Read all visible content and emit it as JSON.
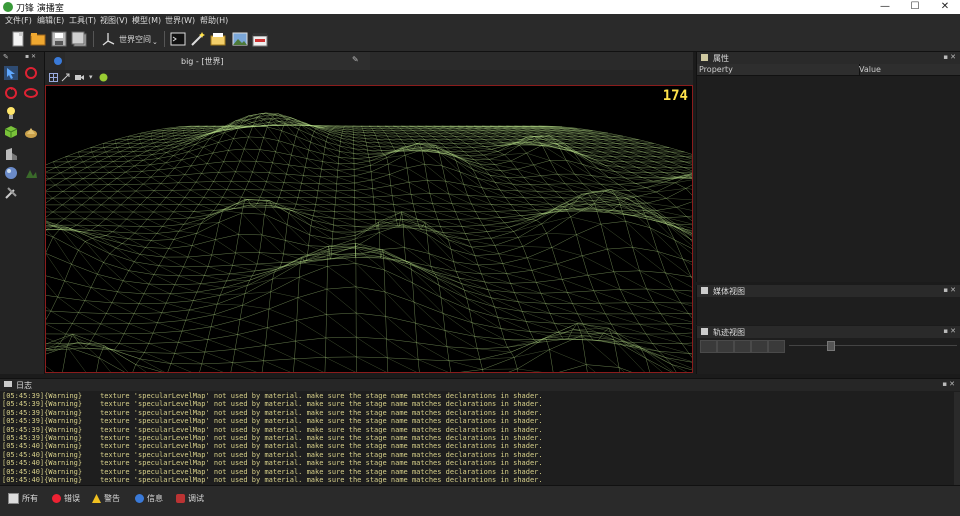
{
  "window": {
    "title": "刀锋 演播室",
    "min": "—",
    "max": "☐",
    "close": "✕"
  },
  "menu": [
    "文件(F)",
    "编辑(E)",
    "工具(T)",
    "视图(V)",
    "模型(M)",
    "世界(W)",
    "帮助(H)"
  ],
  "toolbar": {
    "coord_space": "世界空间"
  },
  "viewport": {
    "tab_title": "big - [世界]",
    "fps": "174"
  },
  "properties": {
    "title": "属性",
    "col_property": "Property",
    "col_value": "Value"
  },
  "media": {
    "title": "媒体视图"
  },
  "track": {
    "title": "轨迹视图"
  },
  "log": {
    "title": "日志",
    "lines": [
      {
        "ts": "[05:45:39]",
        "level": "{Warning}",
        "msg": "texture 'specularLevelMap' not used by material. make sure the stage name matches declarations in shader."
      },
      {
        "ts": "[05:45:39]",
        "level": "{Warning}",
        "msg": "texture 'specularLevelMap' not used by material. make sure the stage name matches declarations in shader."
      },
      {
        "ts": "[05:45:39]",
        "level": "{Warning}",
        "msg": "texture 'specularLevelMap' not used by material. make sure the stage name matches declarations in shader."
      },
      {
        "ts": "[05:45:39]",
        "level": "{Warning}",
        "msg": "texture 'specularLevelMap' not used by material. make sure the stage name matches declarations in shader."
      },
      {
        "ts": "[05:45:39]",
        "level": "{Warning}",
        "msg": "texture 'specularLevelMap' not used by material. make sure the stage name matches declarations in shader."
      },
      {
        "ts": "[05:45:39]",
        "level": "{Warning}",
        "msg": "texture 'specularLevelMap' not used by material. make sure the stage name matches declarations in shader."
      },
      {
        "ts": "[05:45:40]",
        "level": "{Warning}",
        "msg": "texture 'specularLevelMap' not used by material. make sure the stage name matches declarations in shader."
      },
      {
        "ts": "[05:45:40]",
        "level": "{Warning}",
        "msg": "texture 'specularLevelMap' not used by material. make sure the stage name matches declarations in shader."
      },
      {
        "ts": "[05:45:40]",
        "level": "{Warning}",
        "msg": "texture 'specularLevelMap' not used by material. make sure the stage name matches declarations in shader."
      },
      {
        "ts": "[05:45:40]",
        "level": "{Warning}",
        "msg": "texture 'specularLevelMap' not used by material. make sure the stage name matches declarations in shader."
      },
      {
        "ts": "[05:45:40]",
        "level": "{Warning}",
        "msg": "texture 'specularLevelMap' not used by material. make sure the stage name matches declarations in shader."
      }
    ]
  },
  "status": {
    "all": "所有",
    "error": "错误",
    "warning": "警告",
    "info": "信息",
    "debug": "调试"
  },
  "colors": {
    "wire": "#b9e28a",
    "fps": "#ffe24a",
    "viewport_border": "#8a1c1c",
    "log_text": "#d7d08a"
  }
}
